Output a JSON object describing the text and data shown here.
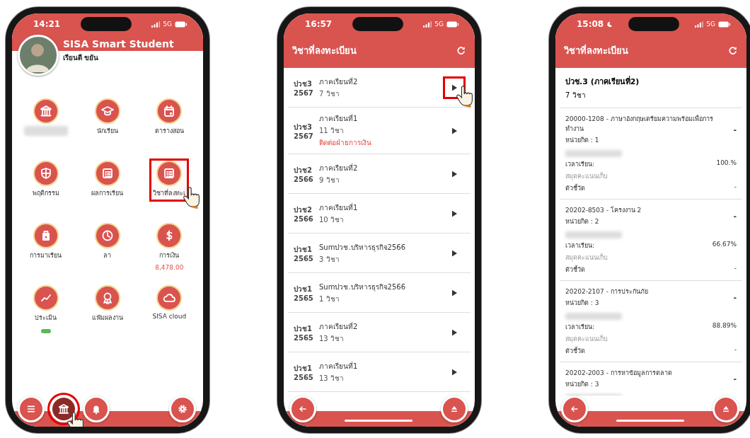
{
  "phones": [
    {
      "kind": "home",
      "status": {
        "time": "14:21",
        "night": false,
        "network": "5G"
      },
      "header": {
        "title": "SISA Smart Student",
        "user": "เรียนดี ขยัน"
      },
      "menu": [
        {
          "blurred_label": true,
          "highlighted": false
        },
        {
          "label": "นักเรียน",
          "highlighted": false
        },
        {
          "label": "ตารางสอน",
          "highlighted": false
        },
        {
          "label": "พฤติกรรม",
          "highlighted": false
        },
        {
          "label": "ผลการเรียน",
          "highlighted": false
        },
        {
          "label": "วิชาที่ลงทะเ",
          "highlighted": true
        },
        {
          "label": "การมาเรียน",
          "highlighted": false
        },
        {
          "label": "ลา",
          "highlighted": false
        },
        {
          "label": "การเงิน",
          "amount": "8,478.00",
          "highlighted": false
        },
        {
          "label": "ประเมิน",
          "indicator": true,
          "highlighted": false
        },
        {
          "label": "แฟ้มผลงาน",
          "highlighted": false
        },
        {
          "label": "SISA cloud",
          "highlighted": false
        }
      ],
      "bottom_nav": [
        {
          "selected": false,
          "highlighted": false
        },
        {
          "selected": true,
          "highlighted": true
        },
        {
          "selected": false,
          "highlighted": false
        },
        {
          "selected": false,
          "highlighted": false
        }
      ]
    },
    {
      "kind": "terms",
      "status": {
        "time": "16:57",
        "night": false,
        "network": "5G"
      },
      "title": "วิชาที่ลงทะเบียน",
      "rows": [
        {
          "level": "ปวช3",
          "year": "2567",
          "term": "ภาคเรียนที่2",
          "count": "7 วิชา",
          "highlighted": true
        },
        {
          "level": "ปวช3",
          "year": "2567",
          "term": "ภาคเรียนที่1",
          "count": "11 วิชา",
          "warning": "ติดต่อฝ่ายการเงิน",
          "highlighted": false
        },
        {
          "level": "ปวช2",
          "year": "2566",
          "term": "ภาคเรียนที่2",
          "count": "9 วิชา",
          "highlighted": false
        },
        {
          "level": "ปวช2",
          "year": "2566",
          "term": "ภาคเรียนที่1",
          "count": "10 วิชา",
          "highlighted": false
        },
        {
          "level": "ปวช1",
          "year": "2565",
          "term": "Sumปวช.บริหารธุรกิจ2566",
          "count": "3 วิชา",
          "highlighted": false
        },
        {
          "level": "ปวช1",
          "year": "2565",
          "term": "Sumปวช.บริหารธุรกิจ2566",
          "count": "1 วิชา",
          "highlighted": false
        },
        {
          "level": "ปวช1",
          "year": "2565",
          "term": "ภาคเรียนที่2",
          "count": "13 วิชา",
          "highlighted": false
        },
        {
          "level": "ปวช1",
          "year": "2565",
          "term": "ภาคเรียนที่1",
          "count": "13 วิชา",
          "highlighted": false
        }
      ]
    },
    {
      "kind": "courses",
      "status": {
        "time": "15:08",
        "night": true,
        "network": "5G"
      },
      "title": "วิชาที่ลงทะเบียน",
      "summary": {
        "title": "ปวช.3 (ภาคเรียนที่2)",
        "count": "7 วิชา"
      },
      "courses": [
        {
          "name": "20000-1208 - ภาษาอังกฤษเตรียมความพร้อมเพื่อการทำงาน",
          "credits": "หน่วยกิต : 1",
          "grade": "-",
          "teacher_blurred": true,
          "attendance_label": "เวลาเรียน:",
          "attendance": "100.%",
          "gradebook": "สมุดคะแนนเก็บ",
          "indicator_label": "ตัวชี้วัด",
          "indicator_value": "-"
        },
        {
          "name": "20202-8503 - โครงงาน 2",
          "credits": "หน่วยกิต : 2",
          "grade": "-",
          "teacher_blurred": true,
          "attendance_label": "เวลาเรียน:",
          "attendance": "66.67%",
          "gradebook": "สมุดคะแนนเก็บ",
          "indicator_label": "ตัวชี้วัด",
          "indicator_value": "-"
        },
        {
          "name": "20202-2107 - การประกันภัย",
          "credits": "หน่วยกิต : 3",
          "grade": "-",
          "teacher_blurred": true,
          "attendance_label": "เวลาเรียน:",
          "attendance": "88.89%",
          "gradebook": "สมุดคะแนนเก็บ",
          "indicator_label": "ตัวชี้วัด",
          "indicator_value": "-"
        },
        {
          "name": "20202-2003 - การหาข้อมูลการตลาด",
          "credits": "หน่วยกิต : 3",
          "grade": "-",
          "teacher_blurred": true
        }
      ]
    }
  ]
}
